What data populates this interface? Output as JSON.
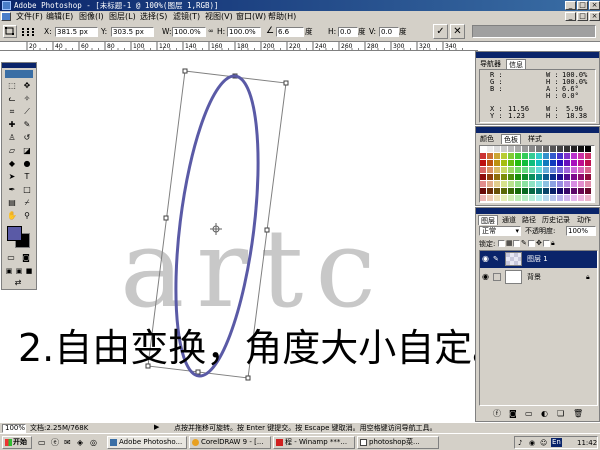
{
  "window": {
    "title": "Adobe Photoshop - [未标题-1 @ 100%(图层 1,RGB)]",
    "controls": [
      "_",
      "□",
      "×"
    ]
  },
  "menu": [
    "文件(F)",
    "编辑(E)",
    "图像(I)",
    "图层(L)",
    "选择(S)",
    "滤镜(T)",
    "视图(V)",
    "窗口(W)",
    "帮助(H)"
  ],
  "options": {
    "x_label": "X:",
    "x_value": "381.5 px",
    "y_label": "Y:",
    "y_value": "303.5 px",
    "w_label": "W:",
    "w_value": "100.0%",
    "h_label": "H:",
    "h_value": "100.0%",
    "angle_value": "6.6",
    "angle_unit": "度",
    "hskew_label": "H:",
    "hskew_value": "0.0",
    "hskew_unit": "度",
    "vskew_label": "V:",
    "vskew_value": "0.0",
    "vskew_unit": "度",
    "commit": "✓",
    "cancel": "✕"
  },
  "ruler": {
    "ticks": [
      "20",
      "40",
      "60",
      "80",
      "100",
      "120",
      "140",
      "160",
      "180",
      "200",
      "220",
      "240",
      "260",
      "280",
      "300",
      "320",
      "340"
    ]
  },
  "canvas": {
    "watermark": "artc",
    "caption": "2.自由变换，角度大小自定。",
    "ellipse_color": "#5a5aa6",
    "watermark_color": "#c8c8c8"
  },
  "navigator": {
    "tabs": [
      "导航器",
      "信息"
    ],
    "active": "信息",
    "readouts": {
      "r": "R :",
      "g": "G :",
      "b": "B :",
      "w1": "W :",
      "w1_val": "100.0%",
      "h1": "H :",
      "h1_val": "100.0%",
      "a": "A :",
      "a_val": "6.6°",
      "h2": "H :",
      "h2_val": "0.0°",
      "x": "X :",
      "x_val": "11.56",
      "y": "Y :",
      "y_val": "1.23",
      "w2": "W :",
      "w2_val": "5.96",
      "h3": "H :",
      "h3_val": "18.38"
    }
  },
  "color_panel": {
    "tabs": [
      "颜色",
      "色板",
      "样式"
    ],
    "active": "色板"
  },
  "layers": {
    "tabs": [
      "图层",
      "通道",
      "路径",
      "历史记录",
      "动作"
    ],
    "active": "图层",
    "blend_mode": "正常",
    "opacity_label": "不透明度:",
    "opacity_value": "100%",
    "lock_label": "锁定:",
    "items": [
      {
        "name": "图层 1",
        "selected": true
      },
      {
        "name": "背景",
        "selected": false
      }
    ]
  },
  "status": {
    "zoom": "100%",
    "doc": "文档:2.25M/768K",
    "hint": "点按并拖移可旋转。按 Enter 键提交。按 Escape 键取消。用空格键访问导航工具。"
  },
  "taskbar": {
    "start": "开始",
    "tasks": [
      "Adobe Photosho...",
      "CorelDRAW 9 - [...",
      "程 - Winamp ***...",
      "photoshop菜..."
    ],
    "lang": "En",
    "time": "11:42"
  }
}
